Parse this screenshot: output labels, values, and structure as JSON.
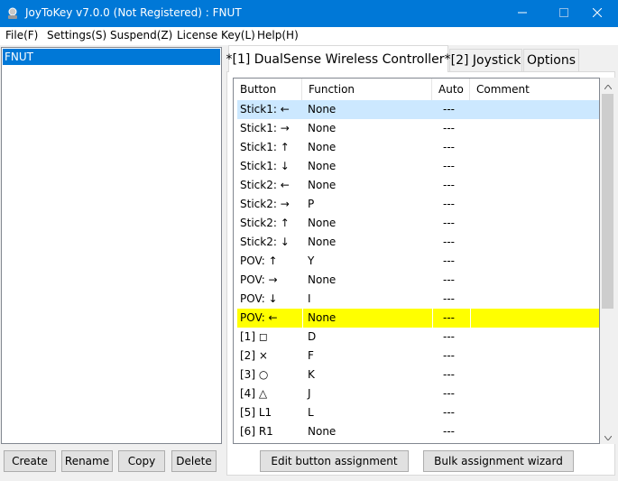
{
  "window": {
    "title": "JoyToKey v7.0.0 (Not Registered) : FNUT",
    "icons": [
      "joystick-app-icon",
      "minimize-icon",
      "maximize-icon",
      "close-icon"
    ]
  },
  "menu": {
    "file": "File(F)",
    "settings": "Settings(S)",
    "suspend": "Suspend(Z)",
    "license": "License Key(L)",
    "help": "Help(H)"
  },
  "profiles": {
    "items": [
      "FNUT"
    ],
    "selected": "FNUT"
  },
  "profile_buttons": {
    "create": "Create",
    "rename": "Rename",
    "copy": "Copy",
    "delete": "Delete"
  },
  "tabs": {
    "controller": "*[1] DualSense Wireless Controller*",
    "joystick": "[2] Joystick",
    "options": "Options"
  },
  "grid": {
    "headers": {
      "button": "Button",
      "function": "Function",
      "auto": "Auto",
      "comment": "Comment"
    },
    "rows": [
      {
        "button": "Stick1: ←",
        "function": "None",
        "auto": "---",
        "comment": "",
        "state": "hover"
      },
      {
        "button": "Stick1: →",
        "function": "None",
        "auto": "---",
        "comment": ""
      },
      {
        "button": "Stick1: ↑",
        "function": "None",
        "auto": "---",
        "comment": ""
      },
      {
        "button": "Stick1: ↓",
        "function": "None",
        "auto": "---",
        "comment": ""
      },
      {
        "button": "Stick2: ←",
        "function": "None",
        "auto": "---",
        "comment": ""
      },
      {
        "button": "Stick2: →",
        "function": "P",
        "auto": "---",
        "comment": ""
      },
      {
        "button": "Stick2: ↑",
        "function": "None",
        "auto": "---",
        "comment": ""
      },
      {
        "button": "Stick2: ↓",
        "function": "None",
        "auto": "---",
        "comment": ""
      },
      {
        "button": "POV: ↑",
        "function": "Y",
        "auto": "---",
        "comment": ""
      },
      {
        "button": "POV: →",
        "function": "None",
        "auto": "---",
        "comment": ""
      },
      {
        "button": "POV: ↓",
        "function": "I",
        "auto": "---",
        "comment": ""
      },
      {
        "button": "POV: ←",
        "function": "None",
        "auto": "---",
        "comment": "",
        "state": "highlighted"
      },
      {
        "button": "[1] ◻",
        "function": "D",
        "auto": "---",
        "comment": ""
      },
      {
        "button": "[2] ×",
        "function": "F",
        "auto": "---",
        "comment": ""
      },
      {
        "button": "[3] ○",
        "function": "K",
        "auto": "---",
        "comment": ""
      },
      {
        "button": "[4] △",
        "function": "J",
        "auto": "---",
        "comment": ""
      },
      {
        "button": "[5] L1",
        "function": "L",
        "auto": "---",
        "comment": ""
      },
      {
        "button": "[6] R1",
        "function": "None",
        "auto": "---",
        "comment": ""
      }
    ]
  },
  "actions": {
    "edit": "Edit button assignment",
    "bulk": "Bulk assignment wizard"
  },
  "colors": {
    "titlebar": "#0078d7",
    "selection": "#0078d7",
    "row_hover": "#cce8ff",
    "row_highlight": "#ffff00"
  }
}
